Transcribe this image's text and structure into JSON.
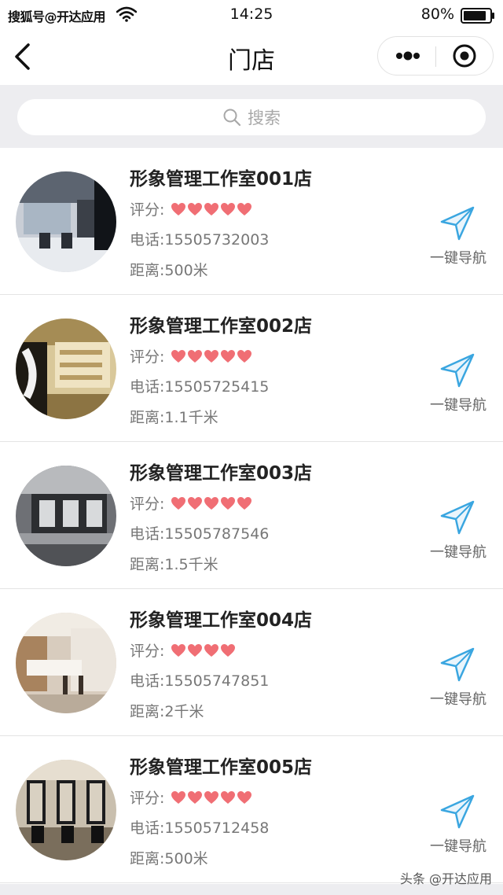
{
  "status_bar": {
    "carrier": "搜狐号@开达应用",
    "time": "14:25",
    "battery": "80%"
  },
  "nav": {
    "title": "门店",
    "back_icon": "chevron-left-icon",
    "more_icon": "more-dots-icon",
    "close_icon": "target-circle-icon"
  },
  "search": {
    "placeholder": "搜索",
    "icon": "search-icon"
  },
  "colors": {
    "heart": "#f06e74",
    "nav_icon": "#3aa6e0",
    "search_bg": "#ededf0",
    "text_muted": "#777777"
  },
  "stores": [
    {
      "name": "形象管理工作室001店",
      "rating_label": "评分:",
      "rating": 5,
      "phone": "电话:15505732003",
      "distance": "距离:500米",
      "nav_label": "一键导航"
    },
    {
      "name": "形象管理工作室002店",
      "rating_label": "评分:",
      "rating": 5,
      "phone": "电话:15505725415",
      "distance": "距离:1.1千米",
      "nav_label": "一键导航"
    },
    {
      "name": "形象管理工作室003店",
      "rating_label": "评分:",
      "rating": 5,
      "phone": "电话:15505787546",
      "distance": "距离:1.5千米",
      "nav_label": "一键导航"
    },
    {
      "name": "形象管理工作室004店",
      "rating_label": "评分:",
      "rating": 4,
      "phone": "电话:15505747851",
      "distance": "距离:2千米",
      "nav_label": "一键导航"
    },
    {
      "name": "形象管理工作室005店",
      "rating_label": "评分:",
      "rating": 5,
      "phone": "电话:15505712458",
      "distance": "距离:500米",
      "nav_label": "一键导航"
    }
  ],
  "watermark": "头条 @开达应用"
}
